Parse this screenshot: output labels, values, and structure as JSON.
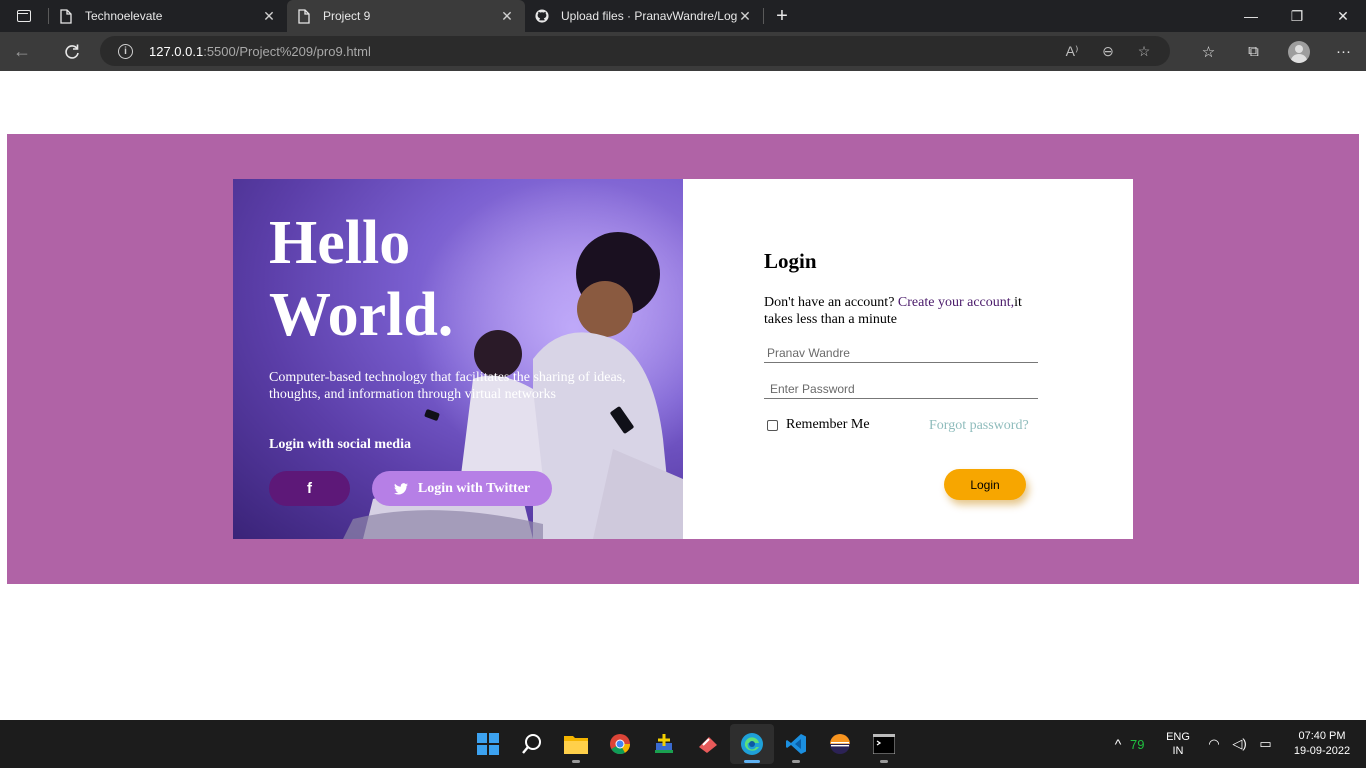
{
  "browser": {
    "tabs": [
      {
        "title": "Technoelevate",
        "icon": "page-icon",
        "active": false
      },
      {
        "title": "Project 9",
        "icon": "page-icon",
        "active": true
      },
      {
        "title": "Upload files · PranavWandre/Log",
        "icon": "github-icon",
        "active": false
      }
    ],
    "url": {
      "host": "127.0.0.1",
      "rest": ":5500/Project%209/pro9.html"
    }
  },
  "hero": {
    "title_line1": "Hello",
    "title_line2": "World.",
    "description": "Computer-based technology that facilitates the sharing of ideas, thoughts, and information through virtual networks",
    "social_title": "Login with social media",
    "facebook_label": "f",
    "twitter_label": "Login with Twitter"
  },
  "login": {
    "title": "Login",
    "signup_prefix": "Don't have an account? ",
    "signup_link": "Create your account,",
    "signup_suffix": "it takes less than a minute",
    "username_placeholder": "Pranav Wandre",
    "password_placeholder": "Enter Password",
    "remember_label": "Remember Me",
    "forgot_label": "Forgot password?",
    "button_label": "Login"
  },
  "colors": {
    "band": "#b063a6",
    "facebook_button": "#5d1878",
    "twitter_button": "#b67fe6",
    "login_button": "#f7a600",
    "forgot_link": "#8fbcbc"
  },
  "taskbar": {
    "apps": [
      "windows-start-icon",
      "search-icon",
      "file-explorer-icon",
      "chrome-icon",
      "app-icon",
      "app-icon",
      "edge-icon",
      "vscode-icon",
      "eclipse-icon",
      "terminal-icon"
    ],
    "temperature": "79",
    "lang_line1": "ENG",
    "lang_line2": "IN",
    "time": "07:40 PM",
    "date": "19-09-2022"
  }
}
